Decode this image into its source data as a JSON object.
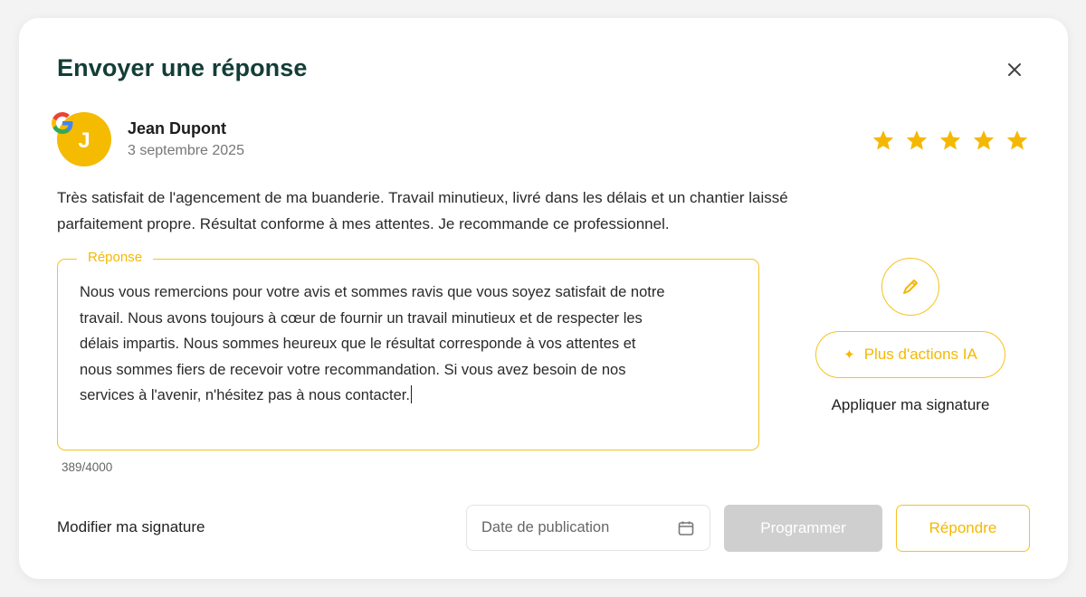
{
  "modal": {
    "title": "Envoyer une réponse",
    "close_icon": "close-icon"
  },
  "reviewer": {
    "initial": "J",
    "name": "Jean Dupont",
    "date": "3 septembre 2025",
    "source_icon": "google-icon",
    "rating": 5,
    "rating_max": 5
  },
  "review": {
    "text_line1": "Très satisfait de l'agencement de ma buanderie. Travail minutieux, livré dans les délais et un chantier laissé",
    "text_line2": "parfaitement propre. Résultat conforme à mes attentes. Je recommande ce professionnel."
  },
  "response": {
    "legend": "Réponse",
    "lines": [
      "Nous vous remercions pour votre avis et sommes ravis que vous soyez satisfait de notre",
      "travail. Nous avons toujours à cœur de fournir un travail minutieux et de respecter les",
      "délais impartis. Nous sommes heureux que le résultat corresponde à vos attentes et",
      "nous sommes fiers de recevoir votre recommandation. Si vous avez besoin de nos",
      "services à l'avenir, n'hésitez pas à nous contacter."
    ],
    "counter": "389/4000"
  },
  "actions": {
    "edit_icon": "pencil-icon",
    "ia_label": "Plus d'actions IA",
    "ia_icon": "sparkle-icon",
    "apply_signature": "Appliquer ma signature",
    "modify_signature": "Modifier ma signature",
    "date_placeholder": "Date de publication",
    "calendar_icon": "calendar-icon",
    "schedule_label": "Programmer",
    "reply_label": "Répondre"
  },
  "colors": {
    "accent": "#f5c221",
    "accent_text": "#f5b800",
    "title": "#143d37",
    "disabled": "#cfcfcf",
    "avatar": "#f5bb00"
  }
}
